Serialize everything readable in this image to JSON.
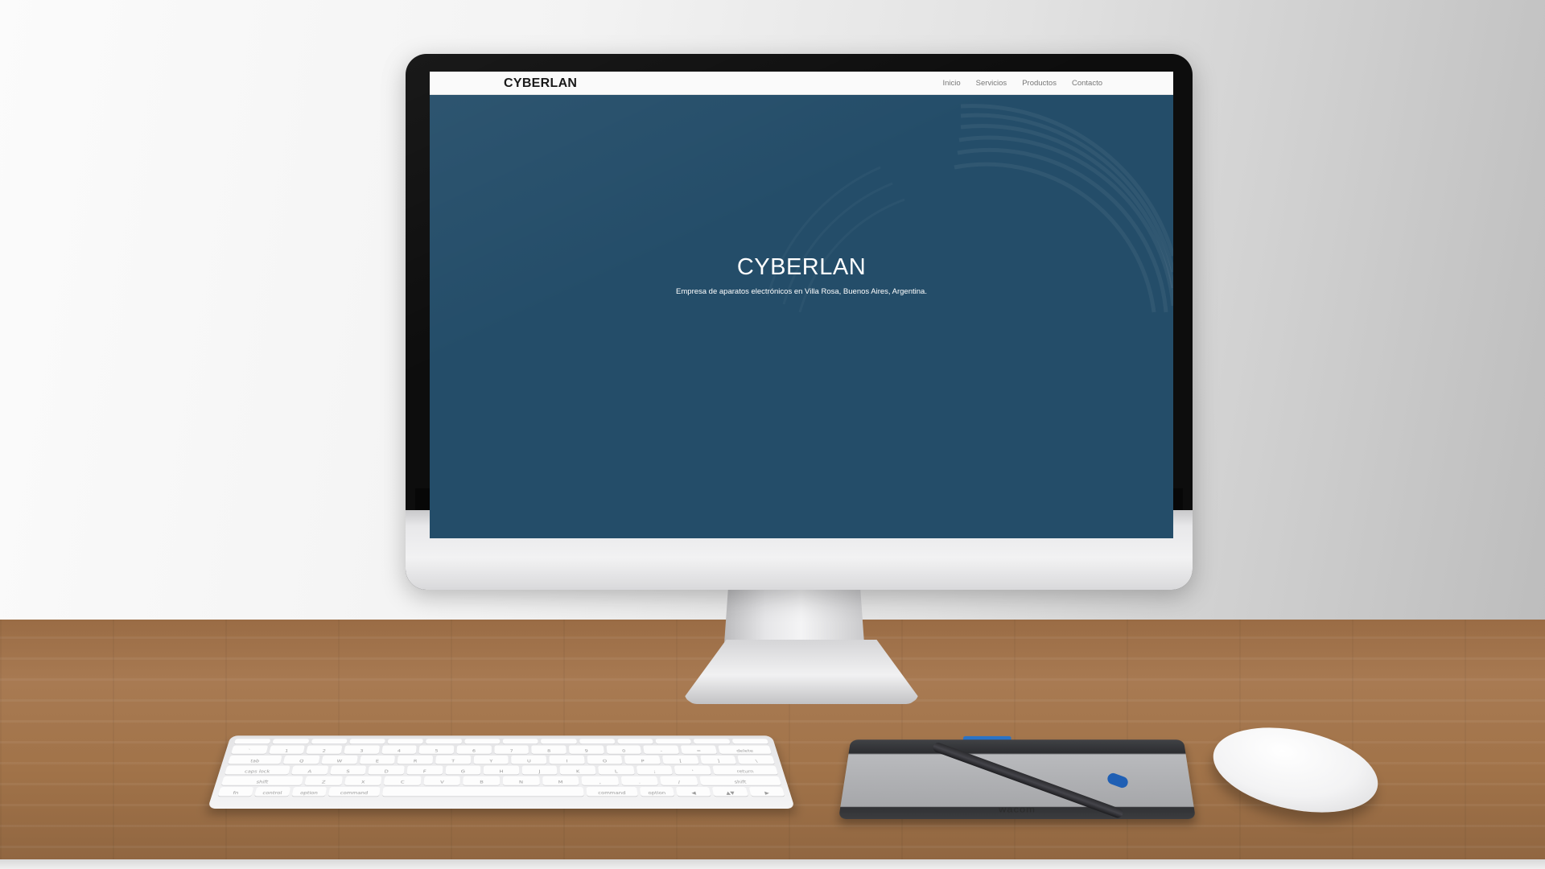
{
  "site": {
    "brand": "CYBERLAN",
    "nav": [
      {
        "label": "Inicio"
      },
      {
        "label": "Servicios"
      },
      {
        "label": "Productos"
      },
      {
        "label": "Contacto"
      }
    ],
    "hero": {
      "title": "CYBERLAN",
      "subtitle": "Empresa de aparatos electrónicos en Villa Rosa, Buenos Aires, Argentina."
    }
  },
  "desk": {
    "tablet_brand": "wacom"
  },
  "keyboard": {
    "row2": [
      "`",
      "1",
      "2",
      "3",
      "4",
      "5",
      "6",
      "7",
      "8",
      "9",
      "0",
      "-",
      "=",
      "delete"
    ],
    "row3": [
      "tab",
      "Q",
      "W",
      "E",
      "R",
      "T",
      "Y",
      "U",
      "I",
      "O",
      "P",
      "[",
      "]",
      "\\"
    ],
    "row4": [
      "caps lock",
      "A",
      "S",
      "D",
      "F",
      "G",
      "H",
      "J",
      "K",
      "L",
      ";",
      "'",
      "return"
    ],
    "row5": [
      "shift",
      "Z",
      "X",
      "C",
      "V",
      "B",
      "N",
      "M",
      ",",
      ".",
      "/",
      "shift"
    ],
    "row6": [
      "fn",
      "control",
      "option",
      "command",
      "",
      "command",
      "option",
      "◀",
      "▲▼",
      "▶"
    ]
  },
  "colors": {
    "hero_bg": "#244d69",
    "navbar_bg": "#fafafa",
    "tablet_accent": "#2a74c8"
  }
}
